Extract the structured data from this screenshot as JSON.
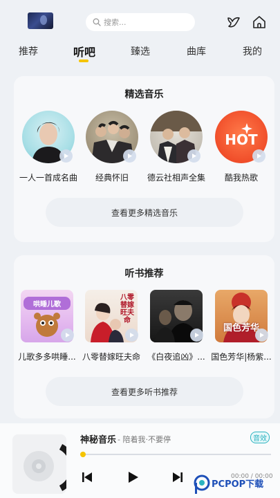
{
  "header": {
    "search_placeholder": "搜索...",
    "icons": [
      "avatar",
      "search-icon",
      "bird-icon",
      "home-icon"
    ]
  },
  "tabs": [
    {
      "label": "推荐",
      "active": false
    },
    {
      "label": "听吧",
      "active": true
    },
    {
      "label": "臻选",
      "active": false
    },
    {
      "label": "曲库",
      "active": false
    },
    {
      "label": "我的",
      "active": false
    }
  ],
  "featured_music": {
    "title": "精选音乐",
    "items": [
      {
        "label": "一人一首成名曲"
      },
      {
        "label": "经典怀旧"
      },
      {
        "label": "德云社相声全集"
      },
      {
        "label": "酷我热歌",
        "badge": "HOT"
      }
    ],
    "more_label": "查看更多精选音乐"
  },
  "audiobooks": {
    "title": "听书推荐",
    "items": [
      {
        "label": "儿歌多多哄睡...",
        "cover_text": "哄睡儿歌"
      },
      {
        "label": "八零替嫁旺夫命",
        "cover_text": "八零替嫁旺夫命"
      },
      {
        "label": "《白夜追凶》...",
        "cover_text": ""
      },
      {
        "label": "国色芳华|杨紫...",
        "cover_text": "国色芳华"
      }
    ],
    "more_label": "查看更多听书推荐"
  },
  "player": {
    "title": "神秘音乐",
    "subtitle": "- 陪着我·不要停",
    "quality": "音效",
    "time": "00:00 / 00:00",
    "progress": 0.0
  },
  "watermark": {
    "text": "PCPOP下载"
  },
  "colors": {
    "accent": "#f5c400",
    "teal": "#2bb3c0",
    "hot": "#f04e2a"
  }
}
